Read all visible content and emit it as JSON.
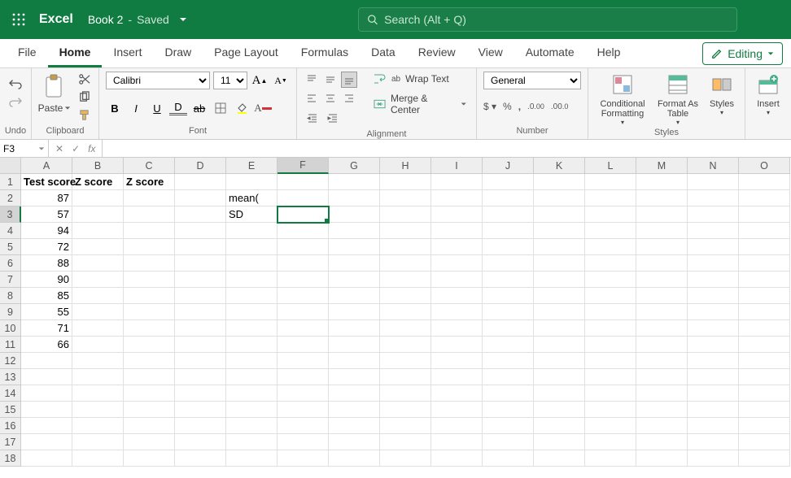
{
  "title": {
    "app": "Excel",
    "doc": "Book 2",
    "status": "Saved"
  },
  "search": {
    "placeholder": "Search (Alt + Q)"
  },
  "tabs": [
    "File",
    "Home",
    "Insert",
    "Draw",
    "Page Layout",
    "Formulas",
    "Data",
    "Review",
    "View",
    "Automate",
    "Help"
  ],
  "activeTab": "Home",
  "editMode": {
    "label": "Editing"
  },
  "ribbon": {
    "undo": "Undo",
    "clipboard": {
      "paste": "Paste",
      "label": "Clipboard"
    },
    "font": {
      "name": "Calibri",
      "size": "11",
      "label": "Font"
    },
    "alignment": {
      "wrap": "Wrap Text",
      "merge": "Merge & Center",
      "label": "Alignment"
    },
    "number": {
      "format": "General",
      "label": "Number"
    },
    "styles": {
      "cond": "Conditional Formatting",
      "fat": "Format As Table",
      "styles": "Styles",
      "label": "Styles"
    },
    "insert": {
      "label": "Insert"
    }
  },
  "namebox": "F3",
  "columns": [
    "A",
    "B",
    "C",
    "D",
    "E",
    "F",
    "G",
    "H",
    "I",
    "J",
    "K",
    "L",
    "M",
    "N",
    "O"
  ],
  "selectedCol": "F",
  "selectedRow": 3,
  "rowCount": 18,
  "cells": {
    "A1": {
      "v": "Test score",
      "bold": true
    },
    "B1": {
      "v": "Z score",
      "bold": true
    },
    "C1": {
      "v": "Z score",
      "bold": true
    },
    "A2": {
      "v": "87",
      "r": true
    },
    "E2": {
      "v": "mean("
    },
    "A3": {
      "v": "57",
      "r": true
    },
    "E3": {
      "v": "SD"
    },
    "A4": {
      "v": "94",
      "r": true
    },
    "A5": {
      "v": "72",
      "r": true
    },
    "A6": {
      "v": "88",
      "r": true
    },
    "A7": {
      "v": "90",
      "r": true
    },
    "A8": {
      "v": "85",
      "r": true
    },
    "A9": {
      "v": "55",
      "r": true
    },
    "A10": {
      "v": "71",
      "r": true
    },
    "A11": {
      "v": "66",
      "r": true
    }
  },
  "activeCell": "F3"
}
